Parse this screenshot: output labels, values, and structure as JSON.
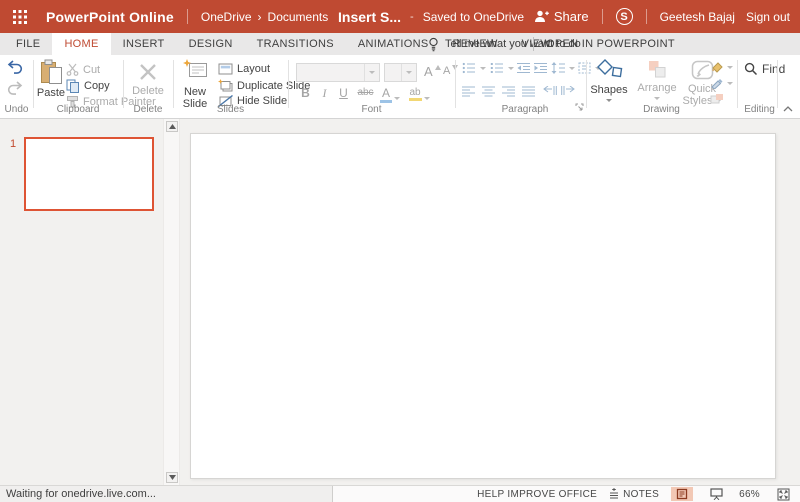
{
  "colors": {
    "brand": "#bf4a32",
    "thumbnail_selection": "#de5434",
    "active_tab_text": "#bf4a32",
    "view_button_active_bg": "#f2c8b5",
    "enabled_icon_blue": "#3d6ea5",
    "disabled_gray": "#ababab"
  },
  "header": {
    "app_title": "PowerPoint Online",
    "breadcrumb_root": "OneDrive",
    "breadcrumb_sep": "›",
    "breadcrumb_current": "Documents",
    "doc_title": "Insert S...",
    "title_dash": "-",
    "save_status": "Saved to OneDrive",
    "share_label": "Share",
    "skype_label": "S",
    "user_name": "Geetesh Bajaj",
    "sign_out": "Sign out"
  },
  "tabs": {
    "items": [
      "FILE",
      "HOME",
      "INSERT",
      "DESIGN",
      "TRANSITIONS",
      "ANIMATIONS",
      "REVIEW",
      "VIEW"
    ],
    "active": "HOME",
    "tell_me": "Tell me what you want to do",
    "open_in": "OPEN IN POWERPOINT"
  },
  "ribbon": {
    "undo": {
      "label": "Undo"
    },
    "clipboard": {
      "label": "Clipboard",
      "paste": "Paste",
      "cut": "Cut",
      "copy": "Copy",
      "format_painter": "Format Painter"
    },
    "delete": {
      "label": "Delete",
      "button": "Delete"
    },
    "slides": {
      "label": "Slides",
      "new_line1": "New",
      "new_line2": "Slide",
      "layout": "Layout",
      "duplicate": "Duplicate Slide",
      "hide": "Hide Slide"
    },
    "font": {
      "label": "Font",
      "bold": "B",
      "italic": "I",
      "underline": "U",
      "strikethrough": "abc",
      "grow": "A",
      "shrink": "A",
      "font_color": "A",
      "highlight": "ab"
    },
    "paragraph": {
      "label": "Paragraph"
    },
    "drawing": {
      "label": "Drawing",
      "shapes": "Shapes",
      "arrange": "Arrange",
      "quick_line1": "Quick",
      "quick_line2": "Styles"
    },
    "editing": {
      "label": "Editing",
      "find": "Find"
    }
  },
  "slide_panel": {
    "slide_number": "1"
  },
  "statusbar": {
    "browser_status": "Waiting for onedrive.live.com...",
    "help": "HELP IMPROVE OFFICE",
    "notes": "NOTES",
    "zoom_level": "66%"
  }
}
